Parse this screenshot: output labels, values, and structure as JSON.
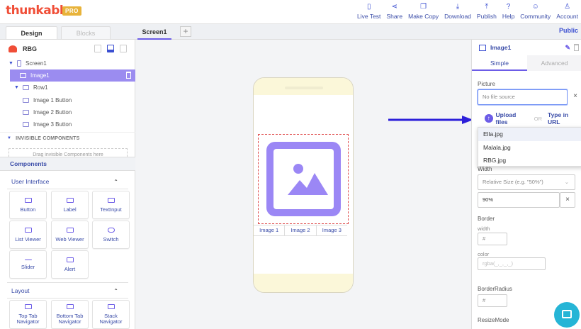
{
  "brand": {
    "name": "thunkable",
    "badge": "PRO"
  },
  "topnav": [
    {
      "label": "Live Test",
      "icon": "phone-icon"
    },
    {
      "label": "Share",
      "icon": "share-icon"
    },
    {
      "label": "Make Copy",
      "icon": "copy-icon"
    },
    {
      "label": "Download",
      "icon": "download-icon"
    },
    {
      "label": "Publish",
      "icon": "publish-icon"
    },
    {
      "label": "Help",
      "icon": "help-icon"
    },
    {
      "label": "Community",
      "icon": "community-icon"
    },
    {
      "label": "Account",
      "icon": "account-icon"
    }
  ],
  "tabs": {
    "design": "Design",
    "blocks": "Blocks",
    "screen": "Screen1",
    "add": "+",
    "public": "Public"
  },
  "tree": {
    "app": "RBG",
    "screen": "Screen1",
    "image": "Image1",
    "row": "Row1",
    "buttons": [
      "Image 1 Button",
      "Image 2 Button",
      "Image 3 Button"
    ],
    "invisible_heading": "INVISIBLE COMPONENTS",
    "drop_hint": "Drag invisible Components here"
  },
  "components": {
    "heading": "Components",
    "ui_heading": "User Interface",
    "ui_items": [
      "Button",
      "Label",
      "TextInput",
      "List Viewer",
      "Web Viewer",
      "Switch",
      "Slider",
      "Alert"
    ],
    "layout_heading": "Layout",
    "layout_items": [
      "Top Tab Navigator",
      "Bottom Tab Navigator",
      "Stack Navigator"
    ]
  },
  "canvas": {
    "row_buttons": [
      "Image 1",
      "Image 2",
      "Image 3"
    ]
  },
  "properties": {
    "component": "Image1",
    "tab_simple": "Simple",
    "tab_advanced": "Advanced",
    "picture_label": "Picture",
    "picture_placeholder": "No file source",
    "clear": "×",
    "upload": "Upload files",
    "or": "OR",
    "type_url": "Type in URL",
    "files": [
      "Ella.jpg",
      "Malala.jpg",
      "RBG.jpg"
    ],
    "width_label": "Width",
    "width_mode": "Relative Size (e.g. \"50%\")",
    "width_value": "90%",
    "border_label": "Border",
    "border_width_label": "width",
    "border_width_value": "#",
    "border_color_label": "color",
    "border_color_value": "rgba(_,_,_,_)",
    "radius_label": "BorderRadius",
    "radius_value": "#",
    "resize_label": "ResizeMode"
  },
  "colors": {
    "brand": "#f04e37",
    "accent": "#6c5ce7",
    "link": "#3a4ca8",
    "chat": "#26b5d6"
  }
}
